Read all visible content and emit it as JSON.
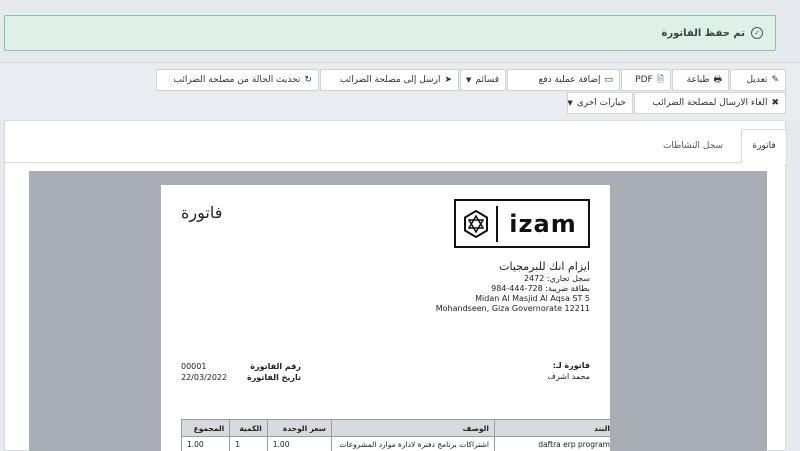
{
  "alert": {
    "message": "تم حفظ الفاتورة",
    "icon": "check-circle-icon"
  },
  "toolbar": {
    "edit": "تعديل",
    "print": "طباعة",
    "pdf": "PDF",
    "add_payment": "إضافة عملية دفع",
    "templates": "قسائم",
    "send_to_tax": "ارسل إلى مصلحة الضرائب",
    "refresh_status": "تحديث الحالة من مصلحة الضرائب",
    "cancel_send": "الغاء الارسال لمصلحة الضرائب",
    "more_options": "خيارات اخرى"
  },
  "tabs": {
    "invoice": "فاتورة",
    "activity_log": "سجل النشاطات"
  },
  "invoice": {
    "title": "فاتورة",
    "logo_text": "izam",
    "company": {
      "name": "ايزام انك للبرمجيات",
      "commercial_register": "سجل تجاري: 2472",
      "tax_card": "بطاقة ضريبة: 728-444-984",
      "address_line1": "Midan Al Masjid Al Aqsa ST 5",
      "address_line2": "Mohandseen, Giza Governorate 12211"
    },
    "bill_to_label": "فاتورة لـ:",
    "bill_to_name": "محمد اشرف",
    "number_label": "رقم الفاتورة",
    "number": "00001",
    "date_label": "تاريخ الفاتورة",
    "date": "22/03/2022",
    "table": {
      "headers": [
        "البند",
        "الوصف",
        "سعر الوحدة",
        "الكمية",
        "المجموع"
      ],
      "rows": [
        [
          "daftra erp program",
          "اشتراكات برنامج دفترة لادارة موارد المشروعات",
          "1.00",
          "1",
          "1.00"
        ]
      ]
    }
  },
  "colors": {
    "alert_bg": "#dff0e8",
    "alert_border": "#84c7a6",
    "viewer_bg": "#a9aeb5"
  }
}
